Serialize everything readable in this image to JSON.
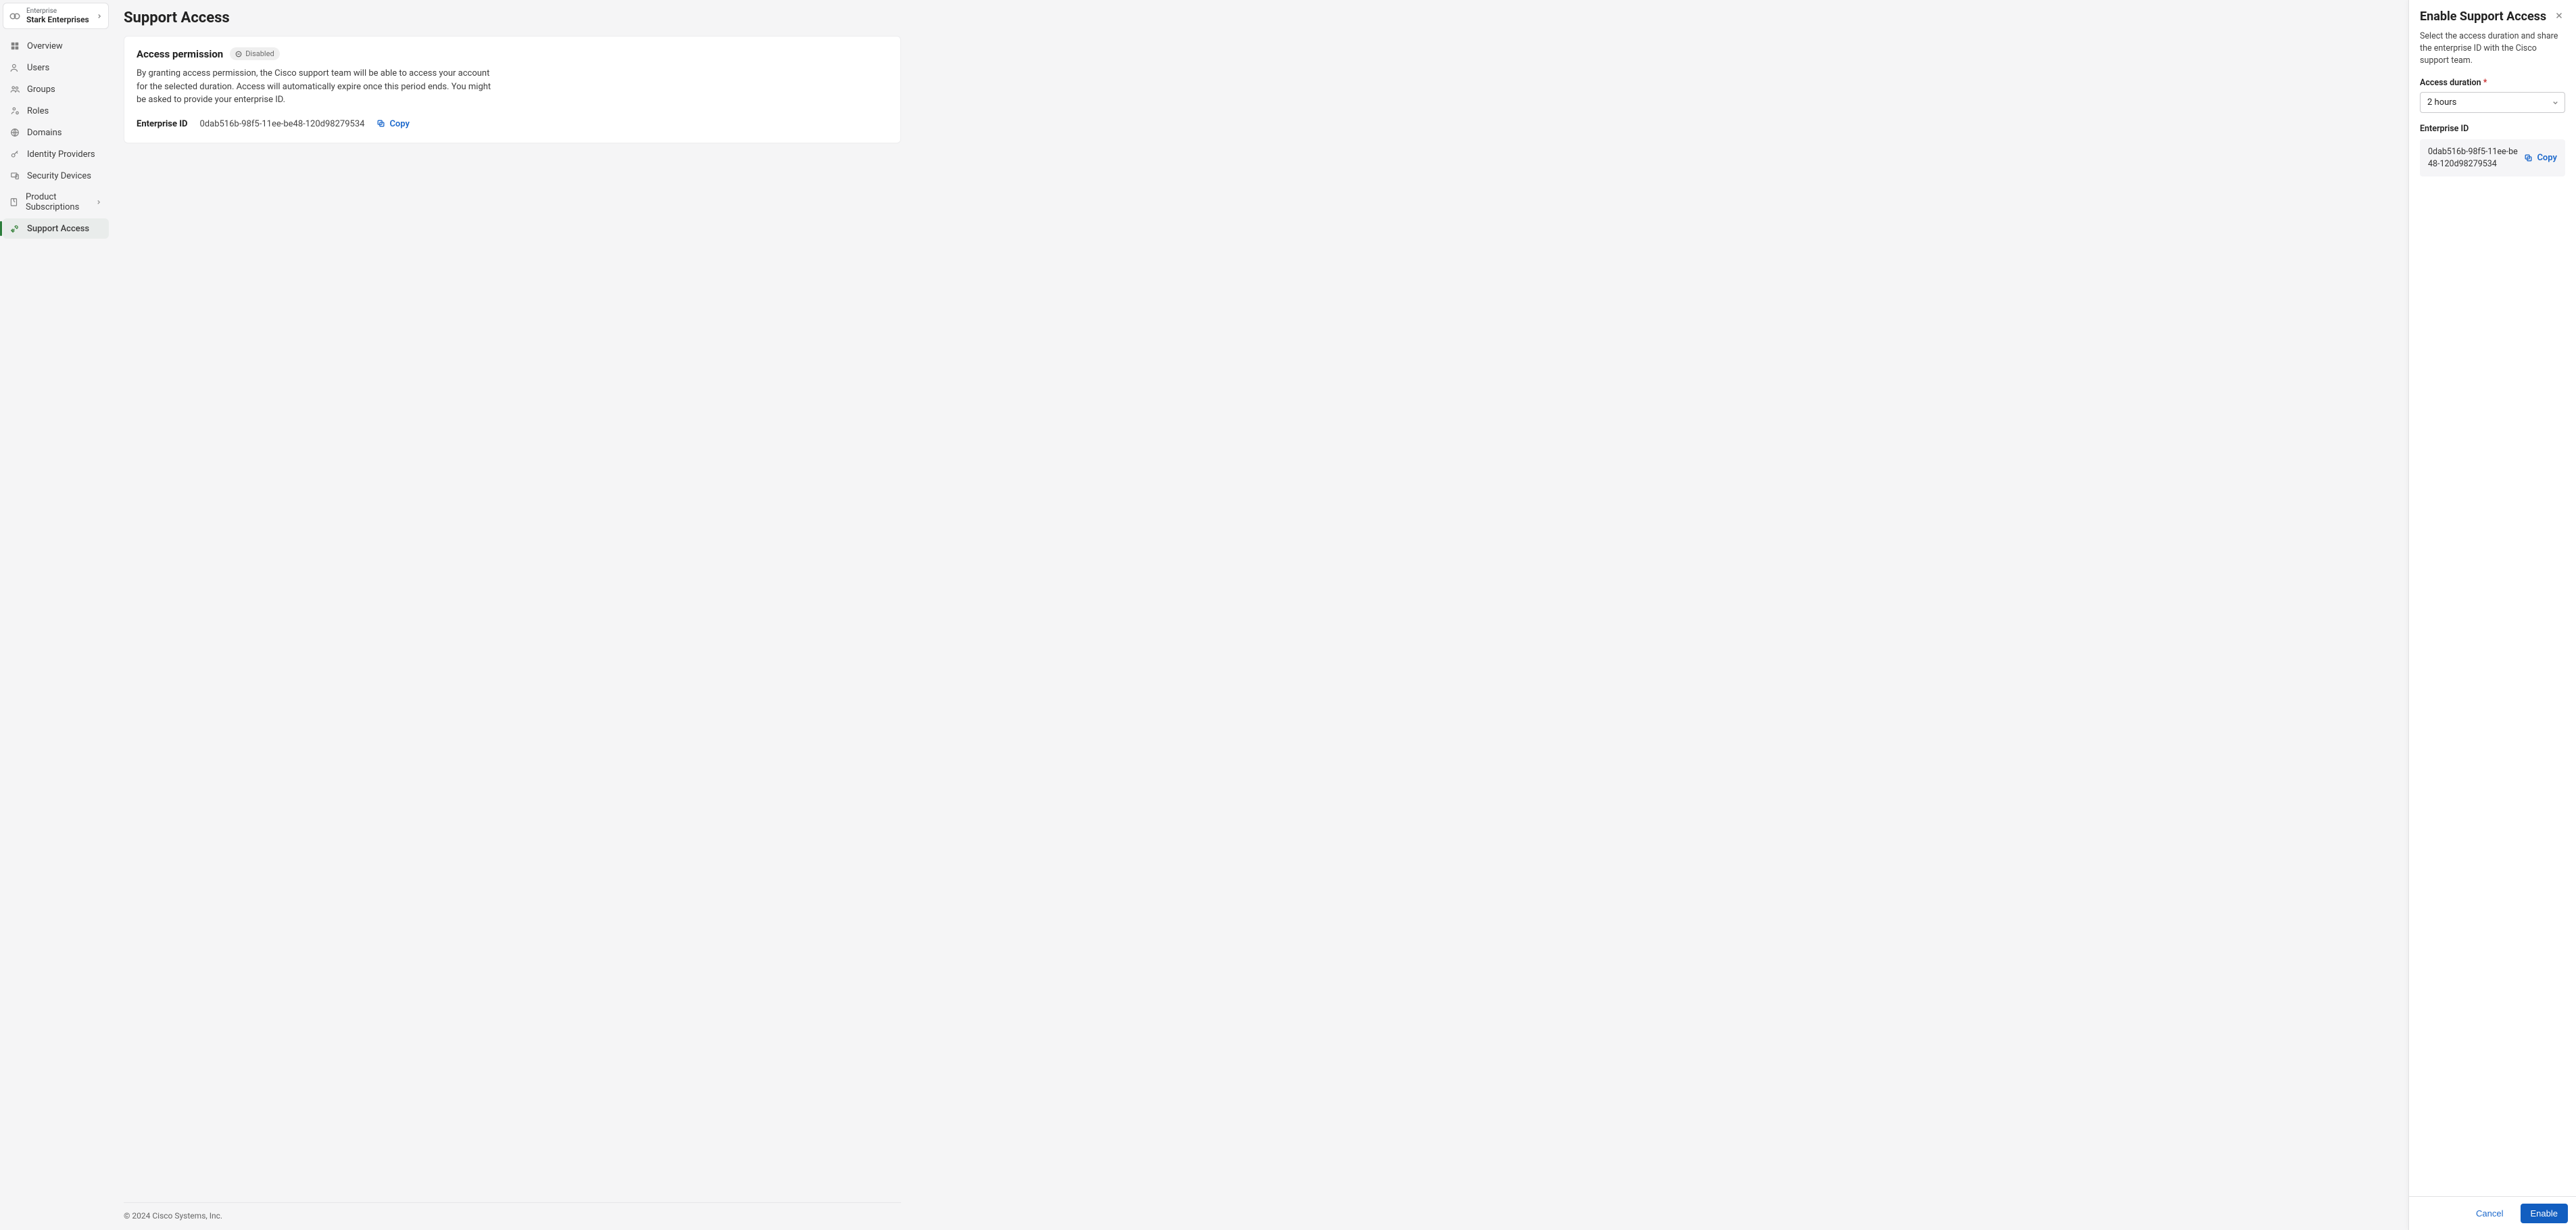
{
  "org": {
    "label": "Enterprise",
    "name": "Stark Enterprises"
  },
  "sidebar": {
    "items": [
      {
        "label": "Overview",
        "icon": "grid-icon"
      },
      {
        "label": "Users",
        "icon": "user-icon"
      },
      {
        "label": "Groups",
        "icon": "group-icon"
      },
      {
        "label": "Roles",
        "icon": "role-icon"
      },
      {
        "label": "Domains",
        "icon": "globe-icon"
      },
      {
        "label": "Identity Providers",
        "icon": "key-icon"
      },
      {
        "label": "Security Devices",
        "icon": "device-icon"
      },
      {
        "label": "Product Subscriptions",
        "icon": "subscription-icon",
        "hasChevron": true
      },
      {
        "label": "Support Access",
        "icon": "tools-icon",
        "active": true
      }
    ]
  },
  "page": {
    "title": "Support Access",
    "card": {
      "title": "Access permission",
      "badge": "Disabled",
      "description": "By granting access permission, the Cisco support team will be able to access your account for the selected duration. Access will automatically expire once this period ends. You might be asked to provide your enterprise ID.",
      "kv": {
        "key": "Enterprise ID",
        "value": "0dab516b-98f5-11ee-be48-120d98279534",
        "copy": "Copy"
      }
    }
  },
  "footer": {
    "text": "© 2024 Cisco Systems, Inc."
  },
  "drawer": {
    "title": "Enable Support Access",
    "description": "Select the access duration and share the enterprise ID with the Cisco support team.",
    "durationLabel": "Access duration",
    "durationValue": "2 hours",
    "idLabel": "Enterprise ID",
    "idValue": "0dab516b-98f5-11ee-be48-120d98279534",
    "copy": "Copy",
    "cancel": "Cancel",
    "enable": "Enable"
  }
}
